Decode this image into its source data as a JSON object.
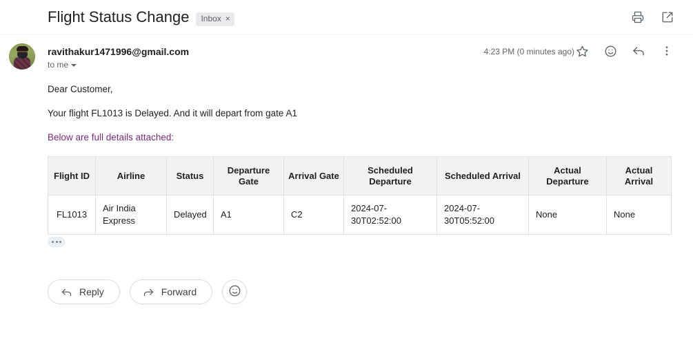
{
  "header": {
    "subject": "Flight Status Change",
    "label": "Inbox",
    "label_remove": "×",
    "print_icon": "print-icon",
    "popout_icon": "open-in-new-icon"
  },
  "message": {
    "sender_email": "ravithakur1471996@gmail.com",
    "recipients": "to me",
    "timestamp": "4:23 PM (0 minutes ago)",
    "star_icon": "star-icon",
    "react_icon": "add-reaction-icon",
    "reply_icon": "reply-icon",
    "more_icon": "more-vert-icon"
  },
  "body": {
    "greeting": "Dear Customer,",
    "status_line": "Your flight FL1013 is Delayed. And it will depart from gate A1",
    "details_intro": "Below are full details attached:",
    "details_intro_color": "#7b2a7e"
  },
  "table": {
    "columns": [
      "Flight ID",
      "Airline",
      "Status",
      "Departure Gate",
      "Arrival Gate",
      "Scheduled Departure",
      "Scheduled Arrival",
      "Actual Departure",
      "Actual Arrival"
    ],
    "rows": [
      {
        "flight_id": "FL1013",
        "airline": "Air India Express",
        "status": "Delayed",
        "departure_gate": "A1",
        "arrival_gate": "C2",
        "scheduled_departure": "2024-07-30T02:52:00",
        "scheduled_arrival": "2024-07-30T05:52:00",
        "actual_departure": "None",
        "actual_arrival": "None"
      }
    ]
  },
  "trimmed": {
    "tooltip": "Show trimmed content"
  },
  "footer": {
    "reply_label": "Reply",
    "forward_label": "Forward",
    "emoji_icon": "add-reaction-icon"
  }
}
